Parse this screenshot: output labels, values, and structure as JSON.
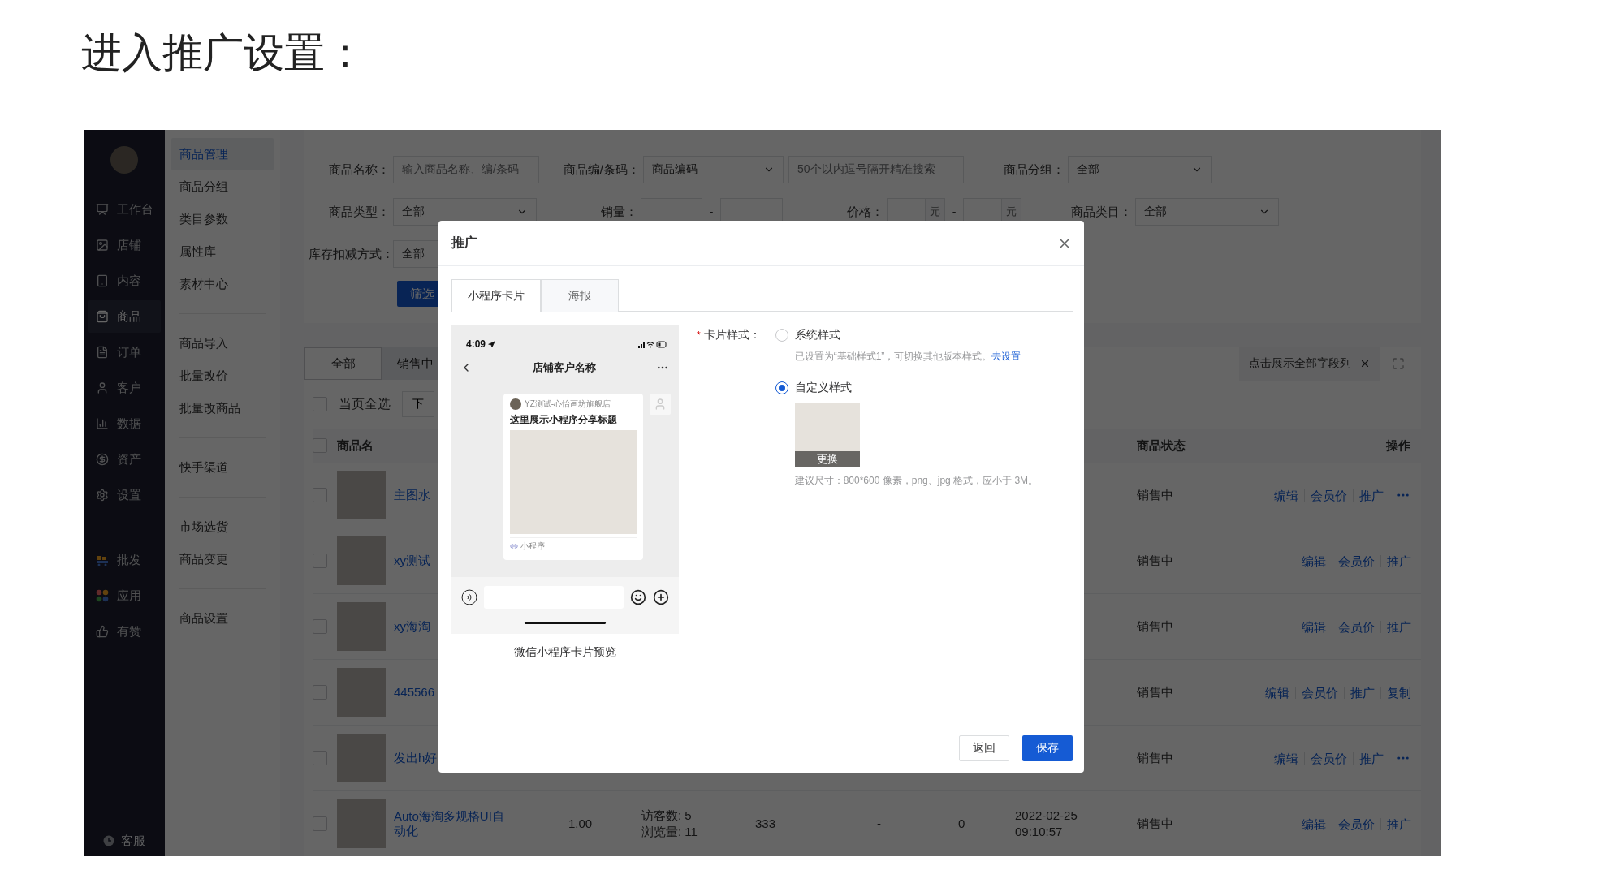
{
  "heading": "进入推广设置：",
  "sidebar": {
    "items": [
      {
        "label": "工作台",
        "selected": false
      },
      {
        "label": "店铺",
        "selected": false
      },
      {
        "label": "内容",
        "selected": false
      },
      {
        "label": "商品",
        "selected": true
      },
      {
        "label": "订单",
        "selected": false
      },
      {
        "label": "客户",
        "selected": false
      },
      {
        "label": "数据",
        "selected": false
      },
      {
        "label": "资产",
        "selected": false
      },
      {
        "label": "设置",
        "selected": false
      }
    ],
    "extra_items": [
      {
        "label": "批发"
      },
      {
        "label": "应用"
      },
      {
        "label": "有赞"
      }
    ],
    "footer": "客服"
  },
  "subnav": {
    "groups": [
      {
        "items": [
          {
            "label": "商品管理",
            "selected": true
          },
          {
            "label": "商品分组",
            "selected": false
          },
          {
            "label": "类目参数",
            "selected": false
          },
          {
            "label": "属性库",
            "selected": false
          },
          {
            "label": "素材中心",
            "selected": false
          }
        ]
      },
      {
        "items": [
          {
            "label": "商品导入",
            "selected": false
          },
          {
            "label": "批量改价",
            "selected": false
          },
          {
            "label": "批量改商品",
            "selected": false
          }
        ]
      },
      {
        "items": [
          {
            "label": "快手渠道",
            "selected": false
          }
        ]
      },
      {
        "items": [
          {
            "label": "市场选货",
            "selected": false
          },
          {
            "label": "商品变更",
            "selected": false
          }
        ]
      },
      {
        "items": [
          {
            "label": "商品设置",
            "selected": false
          }
        ]
      }
    ]
  },
  "filters": {
    "rows": [
      [
        {
          "label": "商品名称：",
          "kind": "input",
          "placeholder": "输入商品名称、编/条码"
        },
        {
          "label": "商品编/条码：",
          "kind": "select_input",
          "value": "商品编码",
          "placeholder": "50个以内逗号隔开精准搜索"
        },
        {
          "label": "商品分组：",
          "kind": "select",
          "value": "全部"
        }
      ],
      [
        {
          "label": "商品类型：",
          "kind": "select",
          "value": "全部"
        },
        {
          "label": "销量：",
          "kind": "range",
          "separator": "-"
        },
        {
          "label": "价格：",
          "kind": "price_range",
          "separator": "-",
          "units": [
            "元",
            "元"
          ]
        },
        {
          "label": "商品类目：",
          "kind": "select",
          "value": "全部"
        }
      ],
      [
        {
          "label": "库存扣减方式：",
          "kind": "select",
          "value": "全部"
        }
      ]
    ],
    "button": "筛选"
  },
  "status_tabs": [
    {
      "label": "全部",
      "selected": true
    },
    {
      "label": "销售中",
      "selected": false
    }
  ],
  "column_toggle": "点击展示全部字段列",
  "bulk": {
    "select_all": "当页全选",
    "checked": false,
    "button": "下"
  },
  "table": {
    "all_checked": false,
    "columns": [
      {
        "label": "商品名"
      },
      {
        "label": "商品状态"
      },
      {
        "label": "操作"
      }
    ],
    "rows": [
      {
        "checked": false,
        "name": "主图水",
        "status": "销售中",
        "actions": [
          "编辑",
          "会员价",
          "推广"
        ],
        "more": true
      },
      {
        "checked": false,
        "name": "xy测试",
        "status": "销售中",
        "actions": [
          "编辑",
          "会员价",
          "推广"
        ],
        "more": false
      },
      {
        "checked": false,
        "name": "xy海淘",
        "status": "销售中",
        "actions": [
          "编辑",
          "会员价",
          "推广"
        ],
        "more": false
      },
      {
        "checked": false,
        "name": "445566",
        "status": "销售中",
        "actions": [
          "编辑",
          "会员价",
          "推广",
          "复制"
        ],
        "more": false
      },
      {
        "checked": false,
        "name": "发出h好",
        "status": "销售中",
        "actions": [
          "编辑",
          "会员价",
          "推广"
        ],
        "more": true
      },
      {
        "checked": false,
        "name": "Auto海淘多规格UI自动化",
        "cells": [
          [
            "1.00"
          ],
          [
            "访客数: 5",
            "浏览量: 11"
          ],
          [
            "333"
          ],
          [
            "-"
          ],
          [
            "0"
          ],
          [
            "2022-02-25",
            "09:10:57"
          ]
        ],
        "status": "销售中",
        "actions": [
          "编辑",
          "会员价",
          "推广"
        ],
        "more": false
      }
    ]
  },
  "modal": {
    "title": "推广",
    "tabs": [
      {
        "label": "小程序卡片",
        "selected": true
      },
      {
        "label": "海报",
        "selected": false
      }
    ],
    "preview": {
      "time": "4:09",
      "chat_title": "店铺客户名称",
      "card": {
        "store": "YZ测试-心怡画坊旗舰店",
        "title": "这里展示小程序分享标题",
        "footer": "小程序"
      },
      "caption": "微信小程序卡片预览"
    },
    "form": {
      "label": "卡片样式：",
      "required_mark": "*",
      "options": [
        {
          "label": "系统样式",
          "selected": false,
          "hint": "已设置为“基础样式1”，可切换其他版本样式。",
          "link": "去设置"
        },
        {
          "label": "自定义样式",
          "selected": true,
          "image_action": "更换",
          "hint": "建议尺寸：800*600 像素，png、jpg 格式，应小于 3M。"
        }
      ]
    },
    "buttons": [
      {
        "label": "返回",
        "kind": "default"
      },
      {
        "label": "保存",
        "kind": "primary"
      }
    ]
  }
}
